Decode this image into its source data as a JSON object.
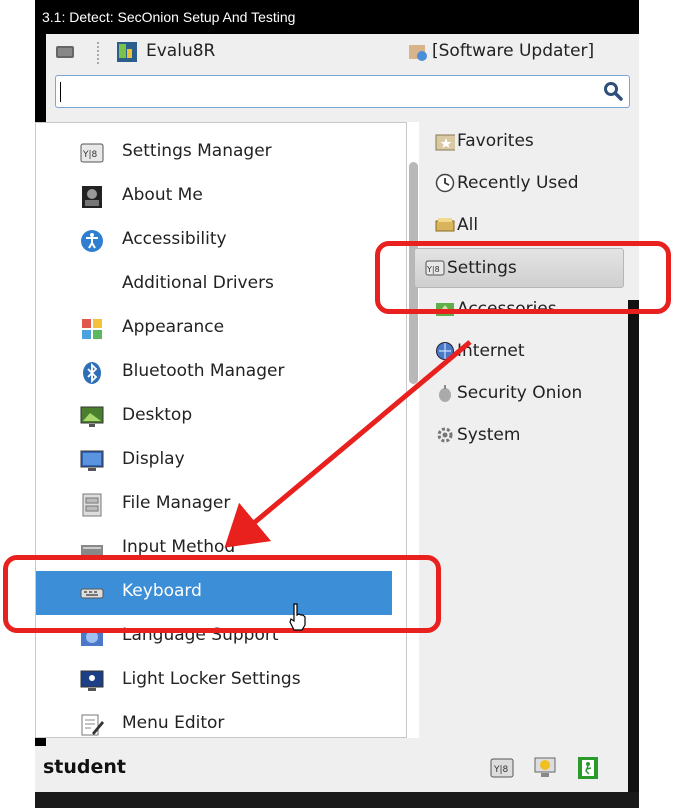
{
  "window": {
    "title": "3.1: Detect: SecOnion Setup And Testing"
  },
  "topbar": {
    "app1_label": "Evalu8R",
    "app2_label": "[Software Updater]"
  },
  "search": {
    "value": "",
    "placeholder": ""
  },
  "apps": [
    {
      "label": "Settings Manager",
      "icon": "settings-manager-icon"
    },
    {
      "label": "About Me",
      "icon": "about-me-icon"
    },
    {
      "label": "Accessibility",
      "icon": "accessibility-icon"
    },
    {
      "label": "Additional Drivers",
      "icon": ""
    },
    {
      "label": "Appearance",
      "icon": "appearance-icon"
    },
    {
      "label": "Bluetooth Manager",
      "icon": "bluetooth-icon"
    },
    {
      "label": "Desktop",
      "icon": "desktop-icon"
    },
    {
      "label": "Display",
      "icon": "display-icon"
    },
    {
      "label": "File Manager",
      "icon": "file-manager-icon"
    },
    {
      "label": "Input Method",
      "icon": "input-method-icon"
    },
    {
      "label": "Keyboard",
      "icon": "keyboard-icon",
      "selected": true
    },
    {
      "label": "Language Support",
      "icon": "language-icon"
    },
    {
      "label": "Light Locker Settings",
      "icon": "light-locker-icon"
    },
    {
      "label": "Menu Editor",
      "icon": "menu-editor-icon"
    }
  ],
  "categories": [
    {
      "label": "Favorites",
      "icon": "favorites-icon"
    },
    {
      "label": "Recently Used",
      "icon": "recent-icon"
    },
    {
      "label": "All",
      "icon": "all-icon"
    },
    {
      "label": "Settings",
      "icon": "settings-icon",
      "active": true
    },
    {
      "label": "Accessories",
      "icon": "accessories-icon"
    },
    {
      "label": "Internet",
      "icon": "internet-icon"
    },
    {
      "label": "Security Onion",
      "icon": "security-onion-icon"
    },
    {
      "label": "System",
      "icon": "system-icon"
    }
  ],
  "bottom": {
    "username": "student"
  },
  "colors": {
    "selection": "#3c8ed6",
    "annotation": "#e8201e"
  }
}
